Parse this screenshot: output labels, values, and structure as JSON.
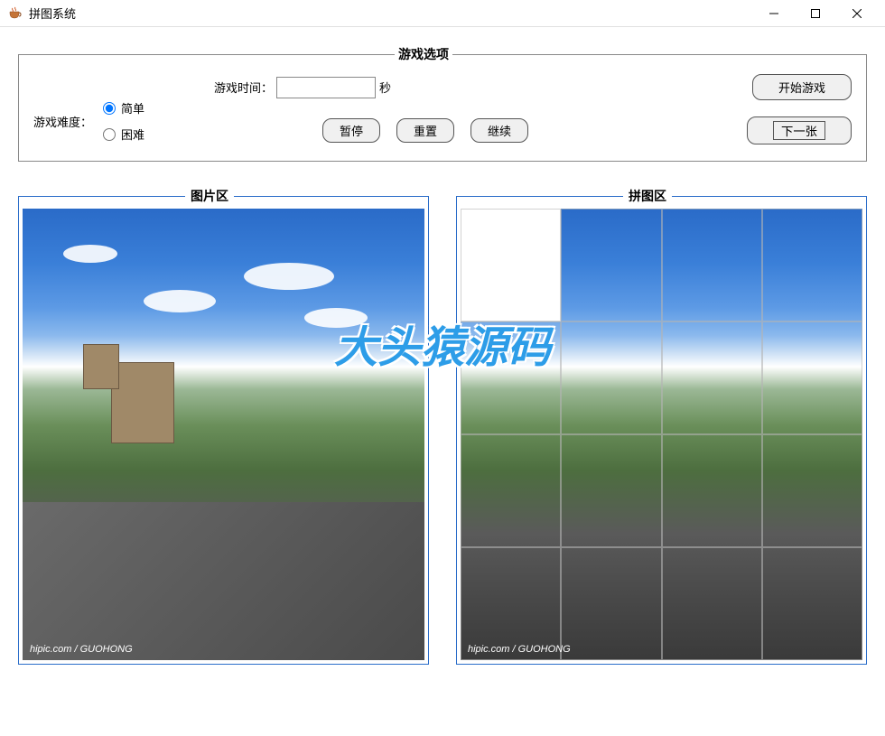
{
  "titlebar": {
    "title": "拼图系统",
    "icon": "java-cup-icon"
  },
  "options": {
    "legend": "游戏选项",
    "difficulty_label": "游戏难度：",
    "difficulty_easy": "简单",
    "difficulty_hard": "困难",
    "time_label": "游戏时间：",
    "time_value": "",
    "time_unit": "秒",
    "start_button": "开始游戏",
    "pause_button": "暂停",
    "reset_button": "重置",
    "continue_button": "继续",
    "next_button": "下一张"
  },
  "panels": {
    "reference_legend": "图片区",
    "puzzle_legend": "拼图区",
    "image_credit": "hipic.com / GUOHONG"
  },
  "watermark": "大头猿源码",
  "puzzle": {
    "grid_size": 4,
    "empty_cell_index": 0
  }
}
